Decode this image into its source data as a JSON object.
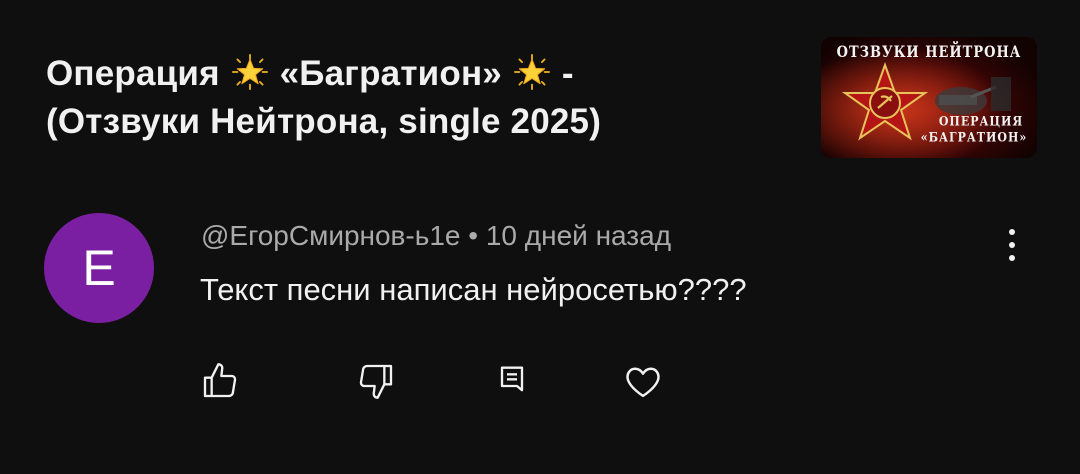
{
  "video": {
    "title_line1_part1": "Операция",
    "title_line1_part2": "«Багратион»",
    "title_line1_part3": "-",
    "title_line2": "(Отзвуки Нейтрона, single 2025)",
    "title_icon": "glowing-star-icon"
  },
  "thumbnail": {
    "top_text": "ОТЗВУКИ НЕЙТРОНА",
    "line1": "ОПЕРАЦИЯ",
    "line2": "«БАГРАТИОН»"
  },
  "comment": {
    "avatar_letter": "Е",
    "avatar_color": "#7b1fa2",
    "meta": "@ЕгорСмирнов-ь1е • 10 дней назад",
    "text": "Текст песни написан нейросетью????"
  },
  "actions": {
    "like_icon": "thumb-up-icon",
    "dislike_icon": "thumb-down-icon",
    "reply_icon": "comment-icon",
    "heart_icon": "heart-icon",
    "more_icon": "more-vertical-icon"
  },
  "colors": {
    "background": "#0f0f0f",
    "primary_text": "#f1f1f1",
    "secondary_text": "#aaaaaa"
  }
}
